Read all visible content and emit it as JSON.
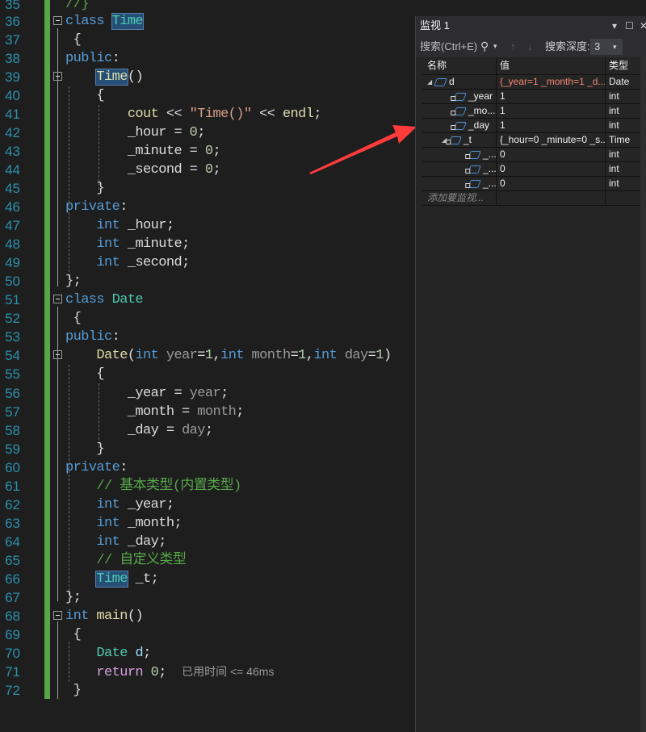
{
  "editor": {
    "lines": [
      {
        "n": "35"
      },
      {
        "n": "36"
      },
      {
        "n": "37"
      },
      {
        "n": "38"
      },
      {
        "n": "39"
      },
      {
        "n": "40"
      },
      {
        "n": "41"
      },
      {
        "n": "42"
      },
      {
        "n": "43"
      },
      {
        "n": "44"
      },
      {
        "n": "45"
      },
      {
        "n": "46"
      },
      {
        "n": "47"
      },
      {
        "n": "48"
      },
      {
        "n": "49"
      },
      {
        "n": "50"
      },
      {
        "n": "51"
      },
      {
        "n": "52"
      },
      {
        "n": "53"
      },
      {
        "n": "54"
      },
      {
        "n": "55"
      },
      {
        "n": "56"
      },
      {
        "n": "57"
      },
      {
        "n": "58"
      },
      {
        "n": "59"
      },
      {
        "n": "60"
      },
      {
        "n": "61"
      },
      {
        "n": "62"
      },
      {
        "n": "63"
      },
      {
        "n": "64"
      },
      {
        "n": "65"
      },
      {
        "n": "66"
      },
      {
        "n": "67"
      },
      {
        "n": "68"
      },
      {
        "n": "69"
      },
      {
        "n": "70"
      },
      {
        "n": "71"
      },
      {
        "n": "72"
      }
    ],
    "tokens": {
      "l35": "//}",
      "class": "class",
      "Time": "Time",
      "Date": "Date",
      "public": "public",
      "private": "private",
      "colon": ":",
      "lbrace": "{",
      "rbrace": "}",
      "rbrace_semi": "};",
      "parens": "()",
      "cout": "cout",
      "shl": " << ",
      "str_time": "\"Time()\"",
      "endl": "endl",
      "semi": ";",
      "hour": "_hour",
      "minute": "_minute",
      "second": "_second",
      "eq0": " = ",
      "zero": "0",
      "int": "int",
      "year_m": "_year",
      "month_m": "_month",
      "day_m": "_day",
      "t_m": "_t",
      "ctor_args_open": "(",
      "year": "year",
      "month": "month",
      "day": "day",
      "eq1": "=",
      "one": "1",
      "comma": ",",
      "close": ")",
      "eq_sp": " = ",
      "cm_builtin": "// 基本类型(内置类型)",
      "cm_custom": "// 自定义类型",
      "main": "main",
      "d": "d",
      "return": "return",
      "elapsed_hint": "已用时间 <= 46ms"
    }
  },
  "watch": {
    "title": "监视 1",
    "search_placeholder": "搜索(Ctrl+E)",
    "depth_label": "搜索深度:",
    "depth_value": "3",
    "columns": {
      "name": "名称",
      "value": "值",
      "type": "类型"
    },
    "rows": [
      {
        "name": "d",
        "value": "{_year=1 _month=1 _d...",
        "type": "Date",
        "changed": true
      },
      {
        "name": "_year",
        "value": "1",
        "type": "int"
      },
      {
        "name": "_mo...",
        "value": "1",
        "type": "int"
      },
      {
        "name": "_day",
        "value": "1",
        "type": "int"
      },
      {
        "name": "_t",
        "value": "{_hour=0 _minute=0 _s...",
        "type": "Time"
      },
      {
        "name": "_...",
        "value": "0",
        "type": "int"
      },
      {
        "name": "_...",
        "value": "0",
        "type": "int"
      },
      {
        "name": "_...",
        "value": "0",
        "type": "int"
      }
    ],
    "add_placeholder": "添加要监视..."
  },
  "annotation": {
    "arrow_color": "#ff3b3b"
  }
}
